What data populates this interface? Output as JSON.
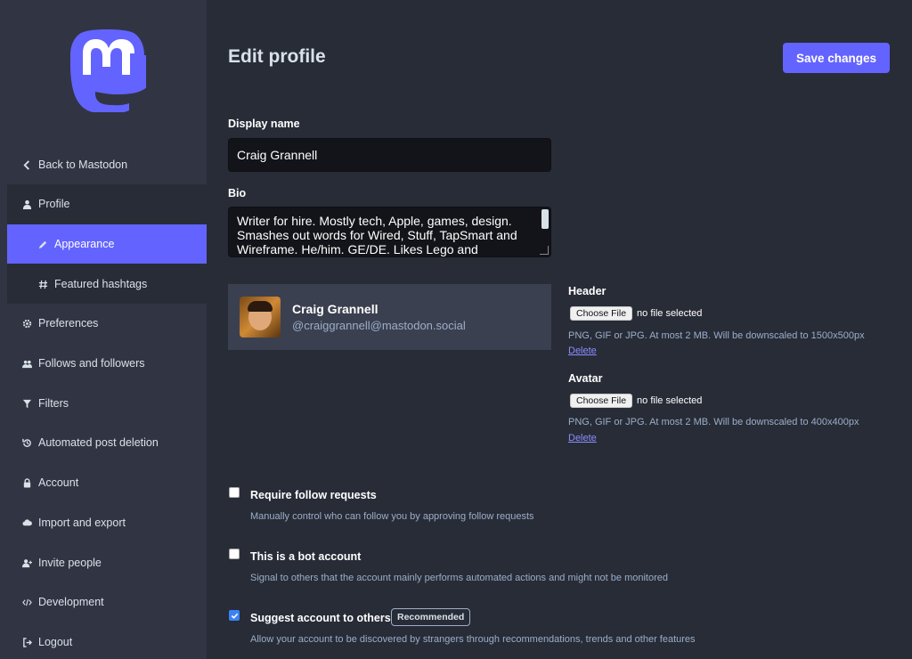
{
  "sidebar": {
    "items": [
      {
        "label": "Back to Mastodon",
        "icon": "chevron-left-icon"
      },
      {
        "label": "Profile",
        "icon": "user-icon"
      },
      {
        "label": "Appearance",
        "icon": "pencil-icon"
      },
      {
        "label": "Featured hashtags",
        "icon": "hashtag-icon"
      },
      {
        "label": "Preferences",
        "icon": "gear-icon"
      },
      {
        "label": "Follows and followers",
        "icon": "users-icon"
      },
      {
        "label": "Filters",
        "icon": "filter-icon"
      },
      {
        "label": "Automated post deletion",
        "icon": "history-icon"
      },
      {
        "label": "Account",
        "icon": "lock-icon"
      },
      {
        "label": "Import and export",
        "icon": "cloud-download-icon"
      },
      {
        "label": "Invite people",
        "icon": "user-plus-icon"
      },
      {
        "label": "Development",
        "icon": "code-icon"
      },
      {
        "label": "Logout",
        "icon": "sign-out-icon"
      }
    ],
    "active": "Appearance"
  },
  "header": {
    "title": "Edit profile",
    "save_label": "Save changes"
  },
  "form": {
    "display_name_label": "Display name",
    "display_name_value": "Craig Grannell",
    "bio_label": "Bio",
    "bio_value": "Writer for hire. Mostly tech, Apple, games, design. Smashes out words for Wired, Stuff, TapSmart and Wireframe. He/him. GE/DE. Likes Lego and"
  },
  "profile_card": {
    "name": "Craig Grannell",
    "handle": "@craiggrannell@mastodon.social"
  },
  "header_image": {
    "label": "Header",
    "button": "Choose File",
    "status": "no file selected",
    "hint": "PNG, GIF or JPG. At most 2 MB. Will be downscaled to 1500x500px",
    "delete": "Delete"
  },
  "avatar_image": {
    "label": "Avatar",
    "button": "Choose File",
    "status": "no file selected",
    "hint": "PNG, GIF or JPG. At most 2 MB. Will be downscaled to 400x400px",
    "delete": "Delete"
  },
  "options": [
    {
      "title": "Require follow requests",
      "desc": "Manually control who can follow you by approving follow requests",
      "checked": false
    },
    {
      "title": "This is a bot account",
      "desc": "Signal to others that the account mainly performs automated actions and might not be monitored",
      "checked": false
    },
    {
      "title": "Suggest account to others",
      "desc": "Allow your account to be discovered by strangers through recommendations, trends and other features",
      "checked": true,
      "badge": "Recommended"
    }
  ],
  "colors": {
    "accent": "#6364ff",
    "background": "#282c37",
    "sidebar": "#313543"
  }
}
